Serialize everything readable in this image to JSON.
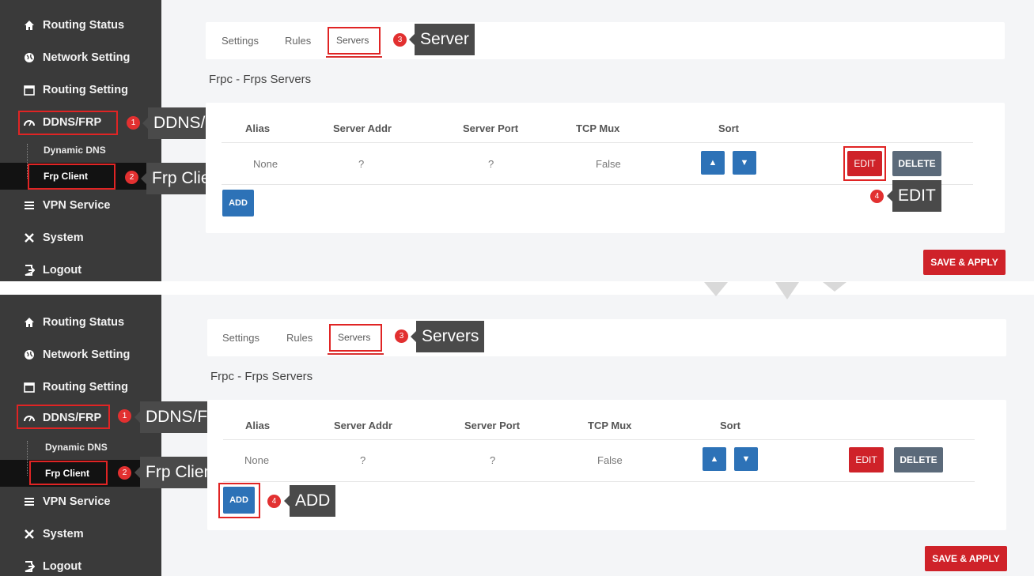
{
  "panels": [
    {
      "sidebar": {
        "items": [
          {
            "label": "Routing Status",
            "icon": "home-icon"
          },
          {
            "label": "Network Setting",
            "icon": "globe-icon"
          },
          {
            "label": "Routing Setting",
            "icon": "calendar-icon"
          },
          {
            "label": "DDNS/FRP",
            "icon": "gauge-icon"
          },
          {
            "label": "VPN Service",
            "icon": "list-icon"
          },
          {
            "label": "System",
            "icon": "tools-icon"
          },
          {
            "label": "Logout",
            "icon": "logout-icon"
          }
        ],
        "subitems": [
          "Dynamic DNS",
          "Frp Client"
        ]
      },
      "tabs": [
        "Settings",
        "Rules",
        "Servers"
      ],
      "section_title": "Frpc - Frps Servers",
      "table": {
        "headers": [
          "Alias",
          "Server Addr",
          "Server Port",
          "TCP Mux",
          "Sort"
        ],
        "rows": [
          [
            "None",
            "?",
            "?",
            "False"
          ]
        ]
      },
      "buttons": {
        "edit": "EDIT",
        "delete": "DELETE",
        "add": "ADD",
        "save": "SAVE & APPLY"
      },
      "callouts": [
        {
          "num": "1",
          "text": "DDNS/FRP"
        },
        {
          "num": "2",
          "text": "Frp Client"
        },
        {
          "num": "3",
          "text": "Server"
        },
        {
          "num": "4",
          "text": "EDIT"
        }
      ]
    },
    {
      "sidebar": {
        "items": [
          {
            "label": "Routing Status",
            "icon": "home-icon"
          },
          {
            "label": "Network Setting",
            "icon": "globe-icon"
          },
          {
            "label": "Routing Setting",
            "icon": "calendar-icon"
          },
          {
            "label": "DDNS/FRP",
            "icon": "gauge-icon"
          },
          {
            "label": "VPN Service",
            "icon": "list-icon"
          },
          {
            "label": "System",
            "icon": "tools-icon"
          },
          {
            "label": "Logout",
            "icon": "logout-icon"
          }
        ],
        "subitems": [
          "Dynamic DNS",
          "Frp Client"
        ]
      },
      "tabs": [
        "Settings",
        "Rules",
        "Servers"
      ],
      "section_title": "Frpc - Frps Servers",
      "table": {
        "headers": [
          "Alias",
          "Server Addr",
          "Server Port",
          "TCP Mux",
          "Sort"
        ],
        "rows": [
          [
            "None",
            "?",
            "?",
            "False"
          ]
        ]
      },
      "buttons": {
        "edit": "EDIT",
        "delete": "DELETE",
        "add": "ADD",
        "save": "SAVE & APPLY"
      },
      "callouts": [
        {
          "num": "1",
          "text": "DDNS/FRP"
        },
        {
          "num": "2",
          "text": "Frp Client"
        },
        {
          "num": "3",
          "text": "Servers"
        },
        {
          "num": "4",
          "text": "ADD"
        }
      ]
    }
  ],
  "colors": {
    "accent_red": "#cf2229",
    "primary_blue": "#2d72b7",
    "sidebar_bg": "#3a3a3a",
    "callout_bg": "#4a4a4a"
  }
}
